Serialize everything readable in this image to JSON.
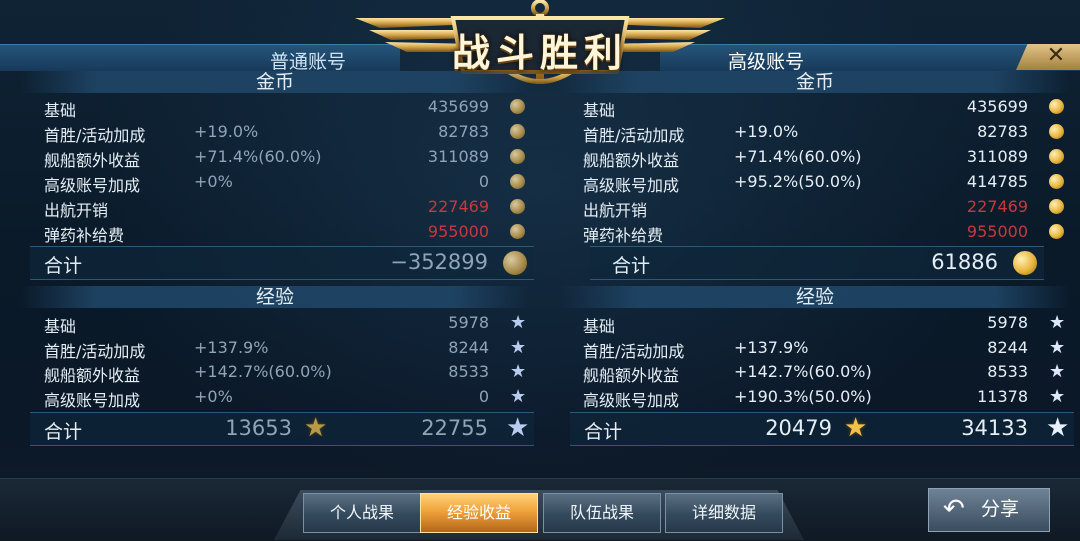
{
  "header": {
    "title": "战斗胜利"
  },
  "close": {
    "label": "✕"
  },
  "normal": {
    "tab_label": "普通账号",
    "gold": {
      "header": "金币",
      "rows": [
        {
          "label": "基础",
          "rate": "",
          "value": "435699"
        },
        {
          "label": "首胜/活动加成",
          "rate": "+19.0%",
          "value": "82783"
        },
        {
          "label": "舰船额外收益",
          "rate": "+71.4%(60.0%)",
          "value": "311089"
        },
        {
          "label": "高级账号加成",
          "rate": "+0%",
          "value": "0"
        },
        {
          "label": "出航开销",
          "rate": "",
          "value": "227469"
        },
        {
          "label": "弹药补给费",
          "rate": "",
          "value": "955000"
        }
      ],
      "total_label": "合计",
      "total_value": "−352899"
    },
    "exp": {
      "header": "经验",
      "rows": [
        {
          "label": "基础",
          "rate": "",
          "value": "5978"
        },
        {
          "label": "首胜/活动加成",
          "rate": "+137.9%",
          "value": "8244"
        },
        {
          "label": "舰船额外收益",
          "rate": "+142.7%(60.0%)",
          "value": "8533"
        },
        {
          "label": "高级账号加成",
          "rate": "+0%",
          "value": "0"
        }
      ],
      "total_label": "合计",
      "total_value_1": "13653",
      "total_value_2": "22755"
    }
  },
  "premium": {
    "tab_label": "高级账号",
    "gold": {
      "header": "金币",
      "rows": [
        {
          "label": "基础",
          "rate": "",
          "value": "435699"
        },
        {
          "label": "首胜/活动加成",
          "rate": "+19.0%",
          "value": "82783"
        },
        {
          "label": "舰船额外收益",
          "rate": "+71.4%(60.0%)",
          "value": "311089"
        },
        {
          "label": "高级账号加成",
          "rate": "+95.2%(50.0%)",
          "value": "414785"
        },
        {
          "label": "出航开销",
          "rate": "",
          "value": "227469"
        },
        {
          "label": "弹药补给费",
          "rate": "",
          "value": "955000"
        }
      ],
      "total_label": "合计",
      "total_value": "61886"
    },
    "exp": {
      "header": "经验",
      "rows": [
        {
          "label": "基础",
          "rate": "",
          "value": "5978"
        },
        {
          "label": "首胜/活动加成",
          "rate": "+137.9%",
          "value": "8244"
        },
        {
          "label": "舰船额外收益",
          "rate": "+142.7%(60.0%)",
          "value": "8533"
        },
        {
          "label": "高级账号加成",
          "rate": "+190.3%(50.0%)",
          "value": "11378"
        }
      ],
      "total_label": "合计",
      "total_value_1": "20479",
      "total_value_2": "34133"
    }
  },
  "footer": {
    "tabs": [
      "个人战果",
      "经验收益",
      "队伍战果",
      "详细数据"
    ],
    "active_tab": "经验收益",
    "share_label": "分享"
  },
  "colors": {
    "cost": "#c8393c",
    "accent_gold": "#f0a23b"
  }
}
